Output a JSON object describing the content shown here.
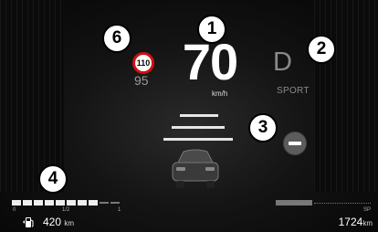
{
  "callouts": [
    "1",
    "2",
    "3",
    "4",
    "6"
  ],
  "speed": {
    "value": "70",
    "unit": "km/h"
  },
  "speed_limit": {
    "sign": "110",
    "set_speed": "95"
  },
  "transmission": {
    "gear": "D",
    "mode": "SPORT"
  },
  "fuel": {
    "gauge_ticks": [
      "0",
      "1/2",
      "1"
    ],
    "level_fraction": 0.82,
    "range_value": "420",
    "range_unit": "km"
  },
  "odometer": {
    "value": "1724",
    "unit": "km",
    "scale_label": "SP"
  },
  "colors": {
    "limit_ring": "#d01010",
    "warning_grey": "#5c5c5c"
  },
  "icons": [
    "fuel-pump-icon",
    "no-entry-icon",
    "lead-car-icon"
  ]
}
